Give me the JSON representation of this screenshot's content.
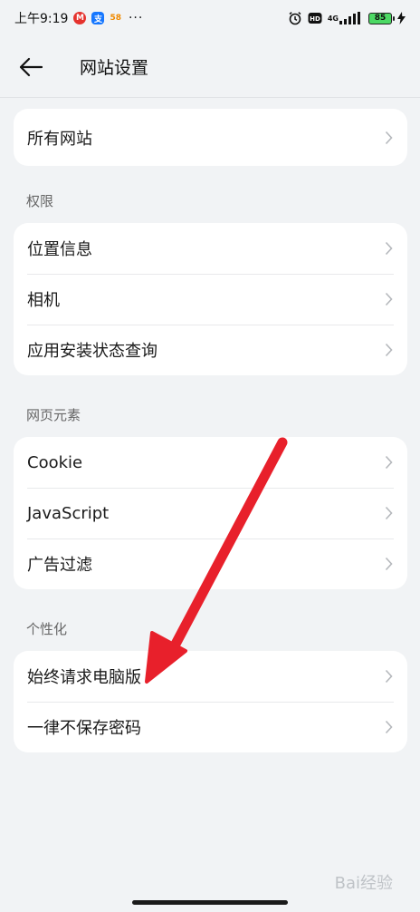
{
  "status": {
    "time": "上午9:19",
    "icon_badge_1": "58",
    "network": "4G",
    "battery": "85"
  },
  "header": {
    "title": "网站设置"
  },
  "sections": {
    "all_sites": {
      "items": [
        {
          "label": "所有网站"
        }
      ]
    },
    "permissions": {
      "title": "权限",
      "items": [
        {
          "label": "位置信息"
        },
        {
          "label": "相机"
        },
        {
          "label": "应用安装状态查询"
        }
      ]
    },
    "web_elements": {
      "title": "网页元素",
      "items": [
        {
          "label": "Cookie"
        },
        {
          "label": "JavaScript"
        },
        {
          "label": "广告过滤"
        }
      ]
    },
    "personalization": {
      "title": "个性化",
      "items": [
        {
          "label": "始终请求电脑版"
        },
        {
          "label": "一律不保存密码"
        }
      ]
    }
  },
  "watermark": "Bai经验",
  "colors": {
    "background": "#f1f3f5",
    "card": "#ffffff",
    "arrow": "#e8202b",
    "battery": "#4cd964"
  }
}
